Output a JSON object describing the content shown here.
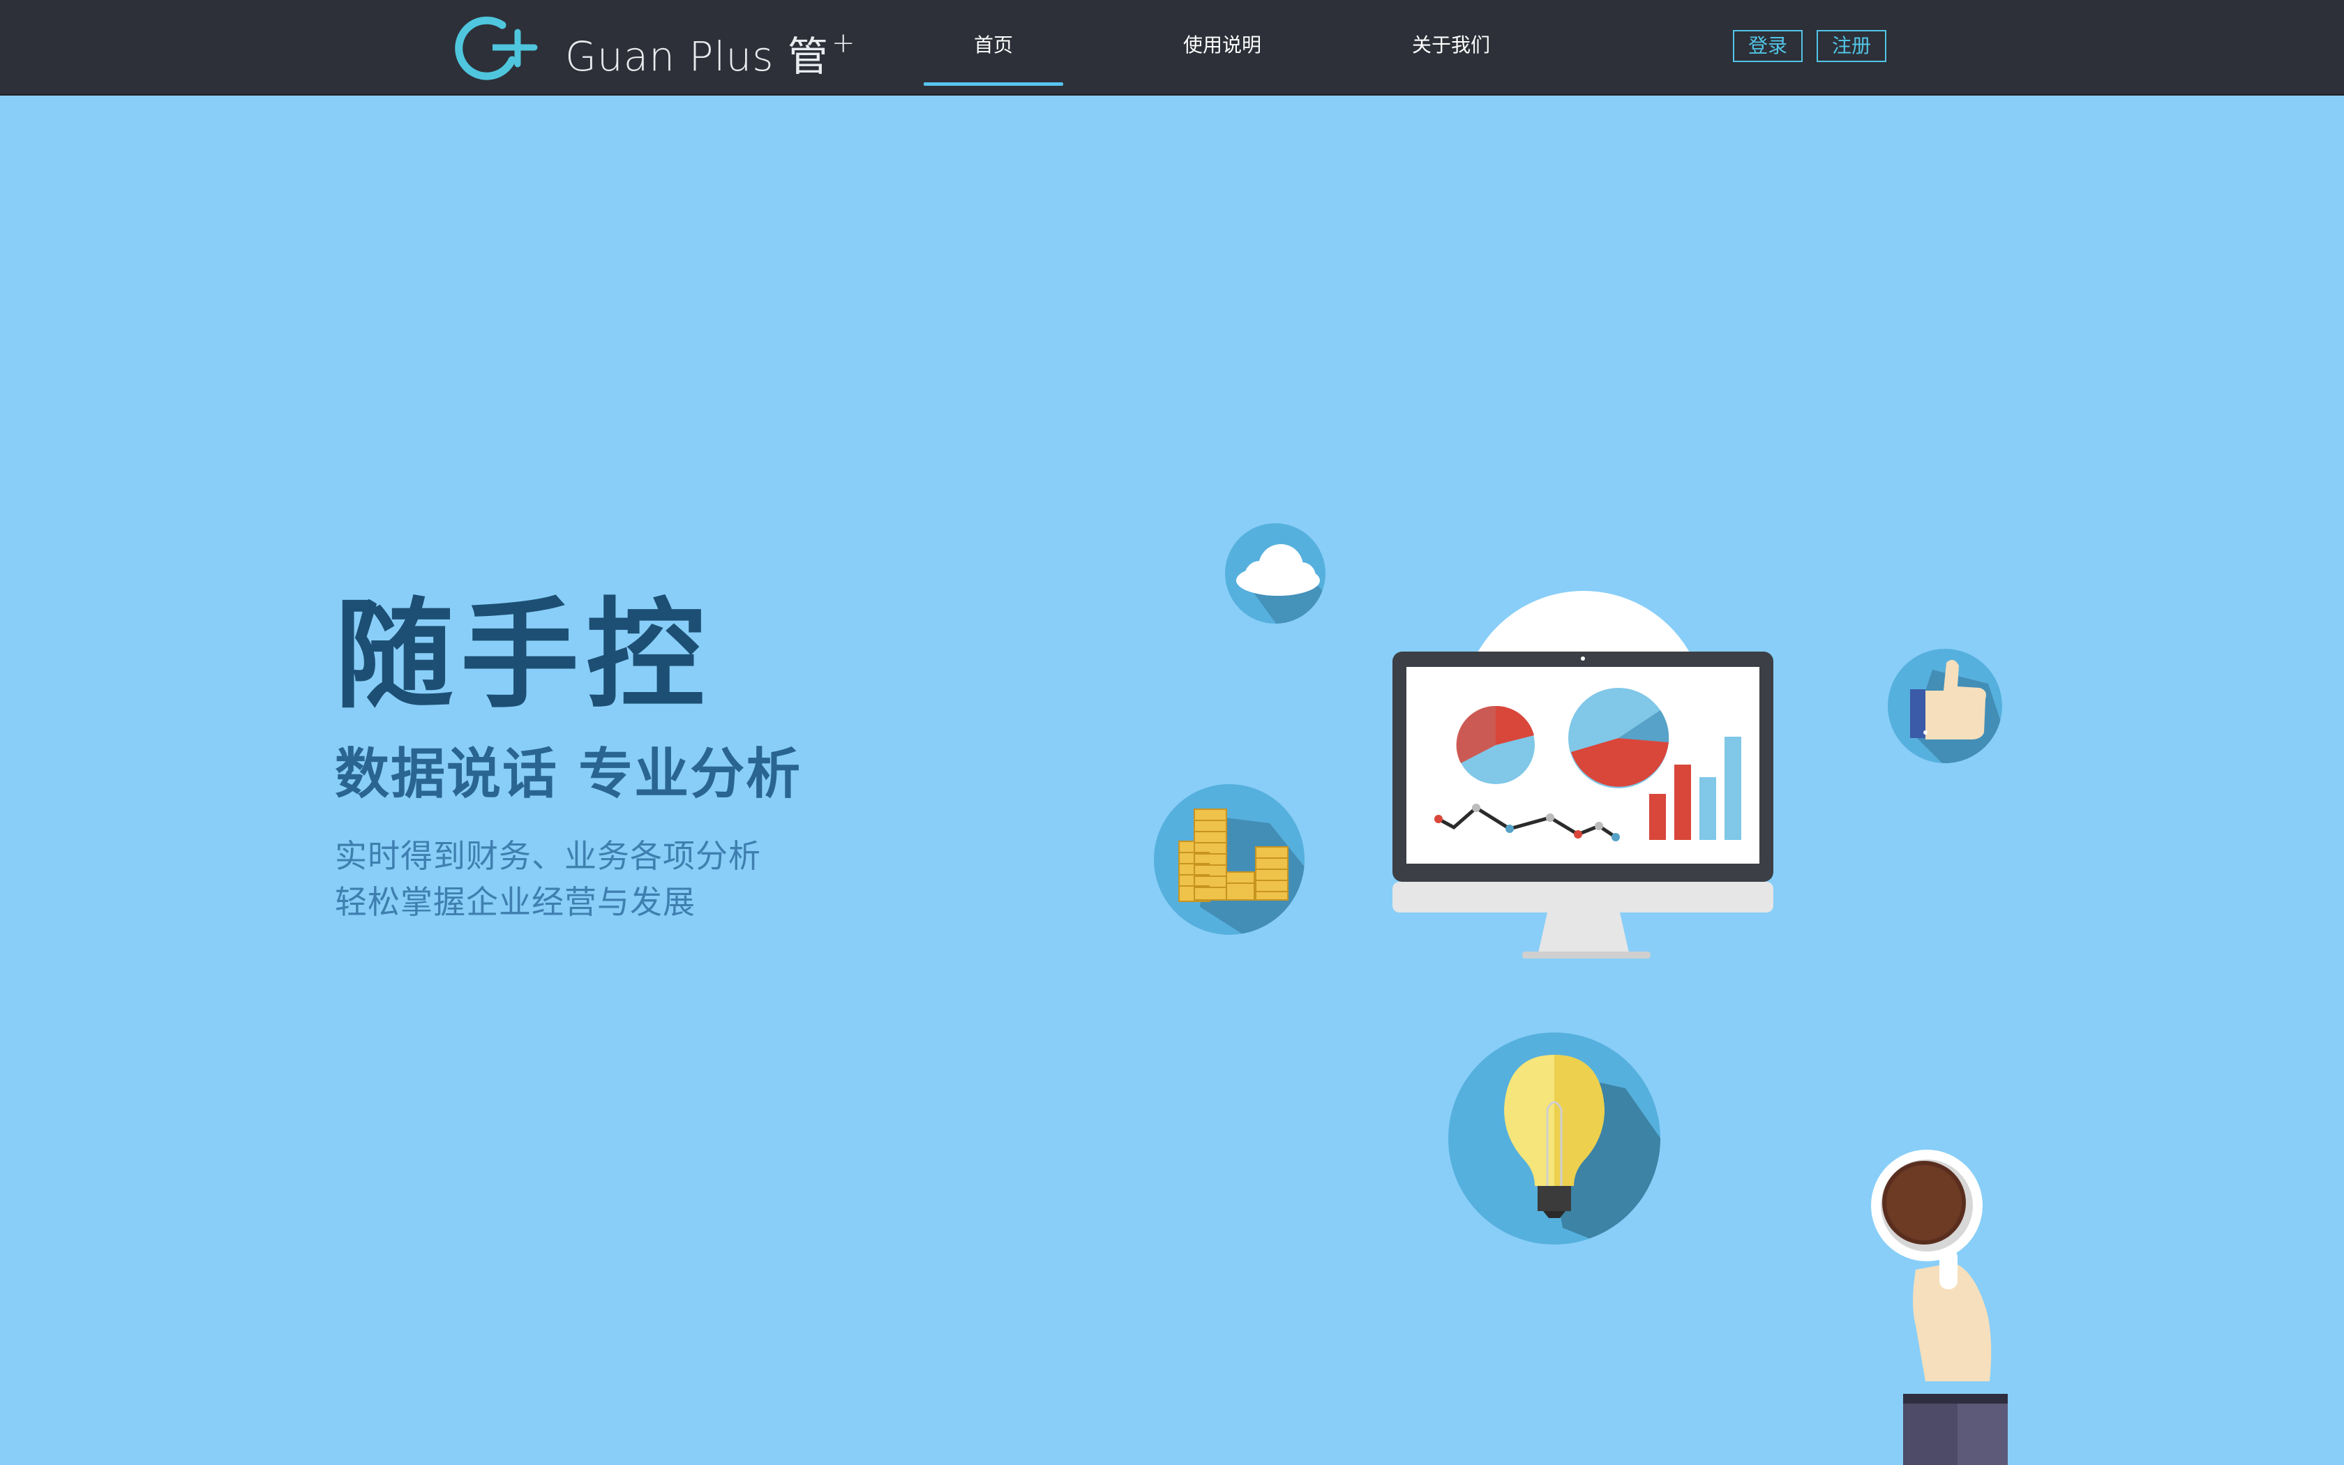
{
  "header": {
    "brand_name": "Guan Plus 管",
    "brand_sup": "+",
    "nav": [
      {
        "label": "首页",
        "active": true
      },
      {
        "label": "使用说明",
        "active": false
      },
      {
        "label": "关于我们",
        "active": false
      }
    ],
    "login_label": "登录",
    "register_label": "注册"
  },
  "hero": {
    "title": "随手控",
    "subtitle": "数据说话 专业分析",
    "desc_lines": [
      "实时得到财务、业务各项分析",
      "轻松掌握企业经营与发展"
    ]
  },
  "illustration": {
    "icons": [
      "cloud-icon",
      "coins-icon",
      "thumbs-up-icon",
      "lightbulb-icon",
      "monitor-icon",
      "coffee-cup-icon"
    ]
  },
  "colors": {
    "background": "#88cef8",
    "header": "#2d3038",
    "accent": "#58c4ef",
    "title": "#1d4f74",
    "subtitle": "#2a6592",
    "desc": "#3f7fb0"
  }
}
